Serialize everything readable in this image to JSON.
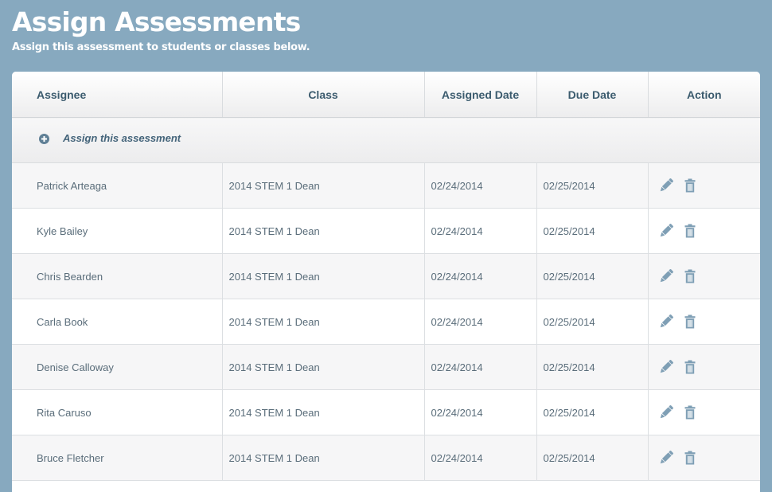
{
  "header": {
    "title": "Assign Assessments",
    "subtitle": "Assign this assessment to students or classes below."
  },
  "table": {
    "columns": {
      "assignee": "Assignee",
      "class": "Class",
      "assigned_date": "Assigned Date",
      "due_date": "Due Date",
      "action": "Action"
    },
    "assign_label": "Assign this assessment",
    "rows": [
      {
        "assignee": "Patrick Arteaga",
        "class": "2014 STEM 1 Dean",
        "assigned_date": "02/24/2014",
        "due_date": "02/25/2014"
      },
      {
        "assignee": "Kyle Bailey",
        "class": "2014 STEM 1 Dean",
        "assigned_date": "02/24/2014",
        "due_date": "02/25/2014"
      },
      {
        "assignee": "Chris Bearden",
        "class": "2014 STEM 1 Dean",
        "assigned_date": "02/24/2014",
        "due_date": "02/25/2014"
      },
      {
        "assignee": "Carla Book",
        "class": "2014 STEM 1 Dean",
        "assigned_date": "02/24/2014",
        "due_date": "02/25/2014"
      },
      {
        "assignee": "Denise Calloway",
        "class": "2014 STEM 1 Dean",
        "assigned_date": "02/24/2014",
        "due_date": "02/25/2014"
      },
      {
        "assignee": "Rita Caruso",
        "class": "2014 STEM 1 Dean",
        "assigned_date": "02/24/2014",
        "due_date": "02/25/2014"
      },
      {
        "assignee": "Bruce Fletcher",
        "class": "2014 STEM 1 Dean",
        "assigned_date": "02/24/2014",
        "due_date": "02/25/2014"
      }
    ],
    "row_actions": [
      "pencil-icon",
      "trash-icon"
    ]
  },
  "colors": {
    "background": "#87a9bf",
    "header_text": "#3b5b6e",
    "icon": "#7f9fb5",
    "cell_text": "#5a6d7a"
  }
}
